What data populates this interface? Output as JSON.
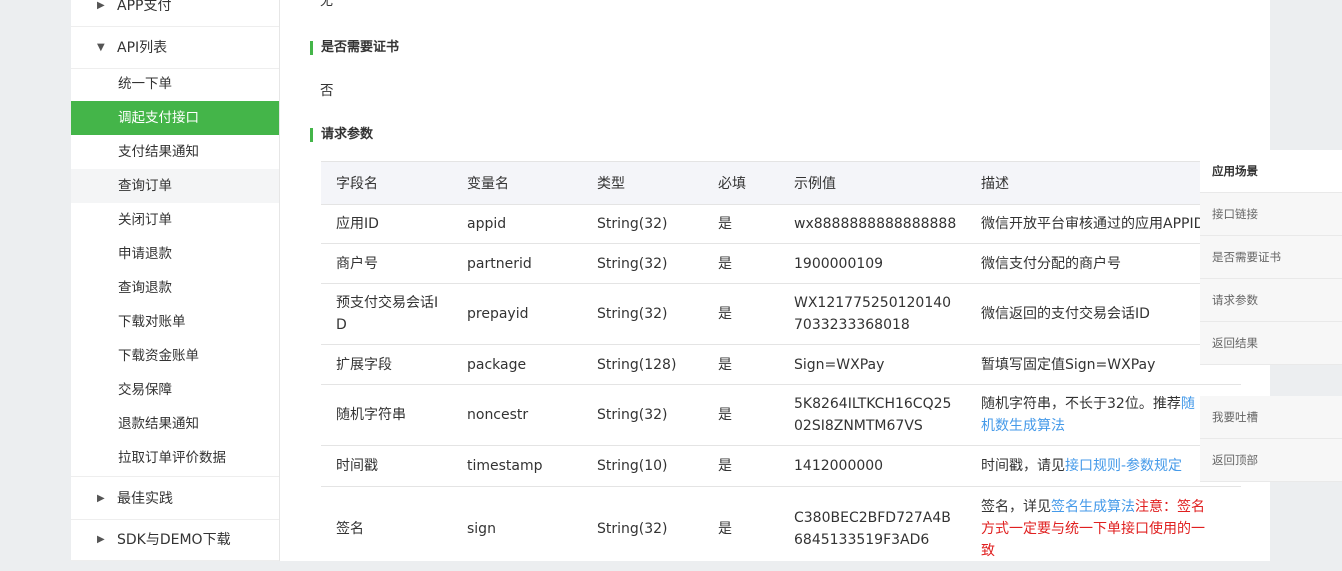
{
  "sidebar": {
    "groups": [
      {
        "label": "APP支付",
        "arrow": "▶"
      },
      {
        "label": "API列表",
        "arrow": "▼"
      },
      {
        "label": "最佳实践",
        "arrow": "▶"
      },
      {
        "label": "SDK与DEMO下载",
        "arrow": "▶"
      }
    ],
    "items": [
      "统一下单",
      "调起支付接口",
      "支付结果通知",
      "查询订单",
      "关闭订单",
      "申请退款",
      "查询退款",
      "下载对账单",
      "下载资金账单",
      "交易保障",
      "退款结果通知",
      "拉取订单评价数据"
    ],
    "active_item": "调起支付接口",
    "accent_color": "#44b549"
  },
  "main": {
    "prev_value": "无",
    "cert_title": "是否需要证书",
    "cert_value": "否",
    "params_title": "请求参数",
    "table": {
      "headers": [
        "字段名",
        "变量名",
        "类型",
        "必填",
        "示例值",
        "描述"
      ],
      "rows": [
        {
          "field": "应用ID",
          "var": "appid",
          "type": "String(32)",
          "required": "是",
          "example": "wx8888888888888888",
          "desc": "微信开放平台审核通过的应用APPID"
        },
        {
          "field": "商户号",
          "var": "partnerid",
          "type": "String(32)",
          "required": "是",
          "example": "1900000109",
          "desc": "微信支付分配的商户号"
        },
        {
          "field": "预支付交易会话ID",
          "var": "prepayid",
          "type": "String(32)",
          "required": "是",
          "example": "WX1217752501201407033233368018",
          "desc": "微信返回的支付交易会话ID"
        },
        {
          "field": "扩展字段",
          "var": "package",
          "type": "String(128)",
          "required": "是",
          "example": "Sign=WXPay",
          "desc": "暂填写固定值Sign=WXPay"
        },
        {
          "field": "随机字符串",
          "var": "noncestr",
          "type": "String(32)",
          "required": "是",
          "example": "5K8264ILTKCH16CQ2502SI8ZNMTM67VS",
          "desc": "随机字符串，不长于32位。推荐",
          "desc_link": "随机数生成算法"
        },
        {
          "field": "时间戳",
          "var": "timestamp",
          "type": "String(10)",
          "required": "是",
          "example": "1412000000",
          "desc": "时间戳，请见",
          "desc_link": "接口规则-参数规定"
        },
        {
          "field": "签名",
          "var": "sign",
          "type": "String(32)",
          "required": "是",
          "example": "C380BEC2BFD727A4B6845133519F3AD6",
          "desc": "签名，详见",
          "desc_link": "签名生成算法",
          "desc_warn": "注意：签名方式一定要与统一下单接口使用的一致"
        }
      ]
    }
  },
  "right_nav": {
    "items": [
      "应用场景",
      "接口链接",
      "是否需要证书",
      "请求参数",
      "返回结果"
    ],
    "current": "应用场景",
    "extra": [
      "我要吐槽",
      "返回顶部"
    ]
  }
}
